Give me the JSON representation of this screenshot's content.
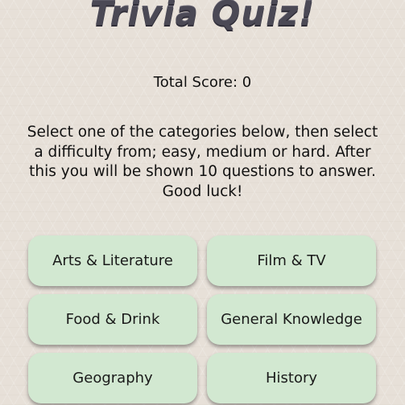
{
  "header": {
    "title": "Trivia Quiz!"
  },
  "score": {
    "label": "Total Score: 0"
  },
  "instructions": {
    "text": "Select one of the categories below, then select a difficulty from; easy, medium or hard. After this you will be shown 10 questions to answer. Good luck!"
  },
  "categories": [
    {
      "label": "Arts & Literature"
    },
    {
      "label": "Film & TV"
    },
    {
      "label": "Food & Drink"
    },
    {
      "label": "General Knowledge"
    },
    {
      "label": "Geography"
    },
    {
      "label": "History"
    }
  ],
  "colors": {
    "background": "#e7e0d8",
    "button": "#d2e8d1",
    "title": "#4b4955"
  }
}
